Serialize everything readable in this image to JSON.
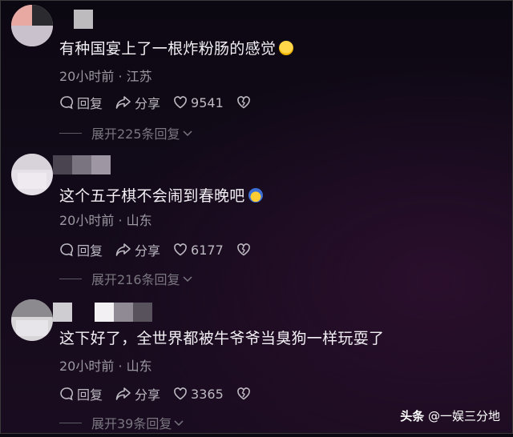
{
  "comments": [
    {
      "text": "有种国宴上了一根炸粉肠的感觉",
      "emoji": "laughing-crying-emoji",
      "meta": "20小时前 · 江苏",
      "reply_label": "回复",
      "share_label": "分享",
      "like_count": "9541",
      "replies_label": "展开225条回复"
    },
    {
      "text": "这个五子棋不会闹到春晚吧",
      "emoji": "scared-emoji",
      "meta": "20小时前 · 山东",
      "reply_label": "回复",
      "share_label": "分享",
      "like_count": "6177",
      "replies_label": "展开216条回复"
    },
    {
      "text": "这下好了，全世界都被牛爷爷当臭狗一样玩耍了",
      "meta": "20小时前 · 山东",
      "reply_label": "回复",
      "share_label": "分享",
      "like_count": "3365",
      "replies_label": "展开39条回复"
    }
  ],
  "watermark": {
    "brand": "头条",
    "handle": "@一娱三分地"
  },
  "colors": {
    "text": "#f2f0f4",
    "meta": "#9b98a1",
    "background": "#120a19"
  }
}
